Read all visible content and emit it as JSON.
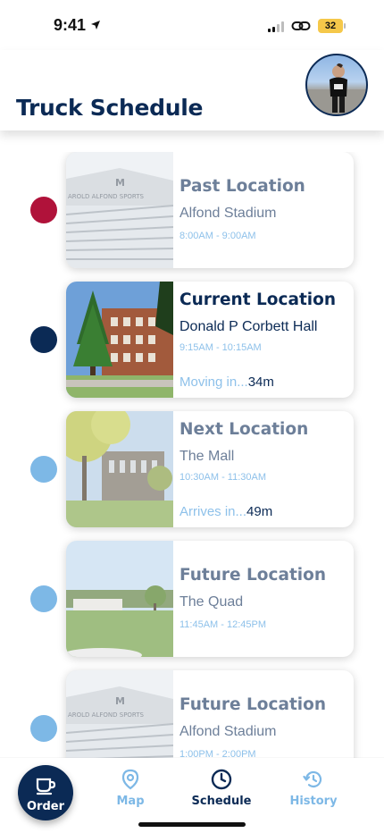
{
  "status_bar": {
    "time": "9:41",
    "battery": "32"
  },
  "header": {
    "title": "Truck Schedule"
  },
  "colors": {
    "navy": "#0b2a55",
    "past": "#b0123a",
    "future": "#7db8e6",
    "light_blue": "#8ec1ea",
    "muted": "#6d7f99"
  },
  "schedule": [
    {
      "title": "Past Location",
      "place": "Alfond Stadium",
      "time": "8:00AM - 9:00AM",
      "eta_label": "",
      "eta_value": ""
    },
    {
      "title": "Current Location",
      "place": "Donald P Corbett Hall",
      "time": "9:15AM - 10:15AM",
      "eta_label": "Moving in...",
      "eta_value": "34m"
    },
    {
      "title": "Next Location",
      "place": "The Mall",
      "time": "10:30AM - 11:30AM",
      "eta_label": "Arrives in...",
      "eta_value": "49m"
    },
    {
      "title": "Future Location",
      "place": "The Quad",
      "time": "11:45AM - 12:45PM",
      "eta_label": "",
      "eta_value": ""
    },
    {
      "title": "Future Location",
      "place": "Alfond Stadium",
      "time": "1:00PM - 2:00PM",
      "eta_label": "",
      "eta_value": ""
    }
  ],
  "nav": {
    "order": "Order",
    "map": "Map",
    "schedule": "Schedule",
    "history": "History",
    "active": "schedule"
  },
  "icons": [
    "location-arrow-icon",
    "signal-icon",
    "link-icon",
    "battery-icon",
    "coffee-cup-icon",
    "map-pin-icon",
    "clock-icon",
    "history-icon"
  ]
}
